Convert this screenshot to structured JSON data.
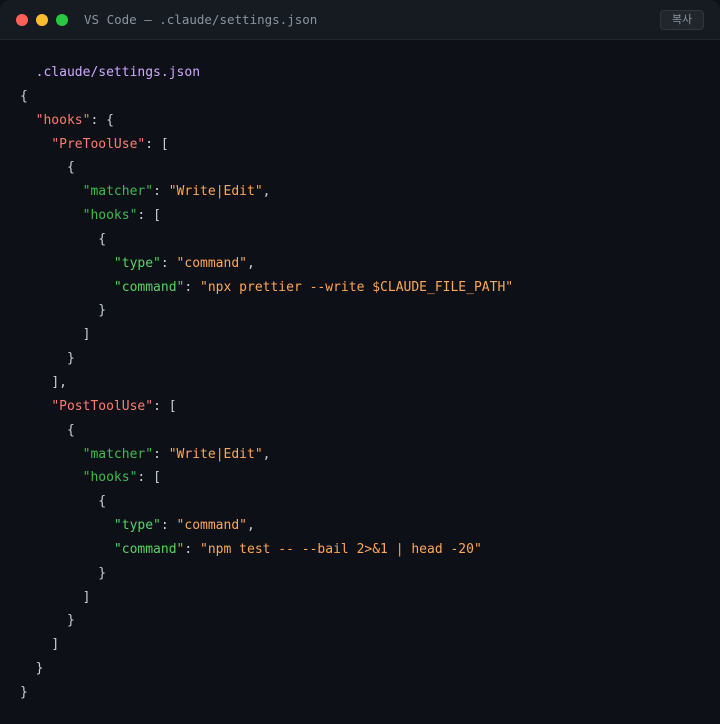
{
  "window": {
    "title": "VS Code — .claude/settings.json",
    "copy_label": "복사",
    "colors": {
      "close": "#ff5f57",
      "minimize": "#febc2e",
      "maximize": "#28c840"
    }
  },
  "editor": {
    "filename": ".claude/settings.json",
    "lines": [
      [
        {
          "t": ".claude/settings.json",
          "c": "filename",
          "indent": 1
        }
      ],
      [
        {
          "t": "{",
          "c": "punc"
        }
      ],
      [
        {
          "t": "\"hooks\"",
          "c": "k1",
          "indent": 1
        },
        {
          "t": ": {",
          "c": "punc"
        }
      ],
      [
        {
          "t": "\"PreToolUse\"",
          "c": "k1",
          "indent": 2
        },
        {
          "t": ": [",
          "c": "punc"
        }
      ],
      [
        {
          "t": "{",
          "c": "punc",
          "indent": 3
        }
      ],
      [
        {
          "t": "\"matcher\"",
          "c": "k2",
          "indent": 4
        },
        {
          "t": ": ",
          "c": "punc"
        },
        {
          "t": "\"Write|Edit\"",
          "c": "str"
        },
        {
          "t": ",",
          "c": "punc"
        }
      ],
      [
        {
          "t": "\"hooks\"",
          "c": "k2",
          "indent": 4
        },
        {
          "t": ": [",
          "c": "punc"
        }
      ],
      [
        {
          "t": "{",
          "c": "punc",
          "indent": 5
        }
      ],
      [
        {
          "t": "\"type\"",
          "c": "k3",
          "indent": 6
        },
        {
          "t": ": ",
          "c": "punc"
        },
        {
          "t": "\"command\"",
          "c": "str"
        },
        {
          "t": ",",
          "c": "punc"
        }
      ],
      [
        {
          "t": "\"command\"",
          "c": "k3",
          "indent": 6
        },
        {
          "t": ": ",
          "c": "punc"
        },
        {
          "t": "\"npx prettier --write $CLAUDE_FILE_PATH\"",
          "c": "str"
        }
      ],
      [
        {
          "t": "}",
          "c": "punc",
          "indent": 5
        }
      ],
      [
        {
          "t": "]",
          "c": "punc",
          "indent": 4
        }
      ],
      [
        {
          "t": "}",
          "c": "punc",
          "indent": 3
        }
      ],
      [
        {
          "t": "],",
          "c": "punc",
          "indent": 2
        }
      ],
      [
        {
          "t": "\"PostToolUse\"",
          "c": "k1",
          "indent": 2
        },
        {
          "t": ": [",
          "c": "punc"
        }
      ],
      [
        {
          "t": "{",
          "c": "punc",
          "indent": 3
        }
      ],
      [
        {
          "t": "\"matcher\"",
          "c": "k2",
          "indent": 4
        },
        {
          "t": ": ",
          "c": "punc"
        },
        {
          "t": "\"Write|Edit\"",
          "c": "str"
        },
        {
          "t": ",",
          "c": "punc"
        }
      ],
      [
        {
          "t": "\"hooks\"",
          "c": "k2",
          "indent": 4
        },
        {
          "t": ": [",
          "c": "punc"
        }
      ],
      [
        {
          "t": "{",
          "c": "punc",
          "indent": 5
        }
      ],
      [
        {
          "t": "\"type\"",
          "c": "k3",
          "indent": 6
        },
        {
          "t": ": ",
          "c": "punc"
        },
        {
          "t": "\"command\"",
          "c": "str"
        },
        {
          "t": ",",
          "c": "punc"
        }
      ],
      [
        {
          "t": "\"command\"",
          "c": "k3",
          "indent": 6
        },
        {
          "t": ": ",
          "c": "punc"
        },
        {
          "t": "\"npm test -- --bail 2>&1 | head -20\"",
          "c": "str"
        }
      ],
      [
        {
          "t": "}",
          "c": "punc",
          "indent": 5
        }
      ],
      [
        {
          "t": "]",
          "c": "punc",
          "indent": 4
        }
      ],
      [
        {
          "t": "}",
          "c": "punc",
          "indent": 3
        }
      ],
      [
        {
          "t": "]",
          "c": "punc",
          "indent": 2
        }
      ],
      [
        {
          "t": "}",
          "c": "punc",
          "indent": 1
        }
      ],
      [
        {
          "t": "}",
          "c": "punc"
        }
      ]
    ]
  }
}
